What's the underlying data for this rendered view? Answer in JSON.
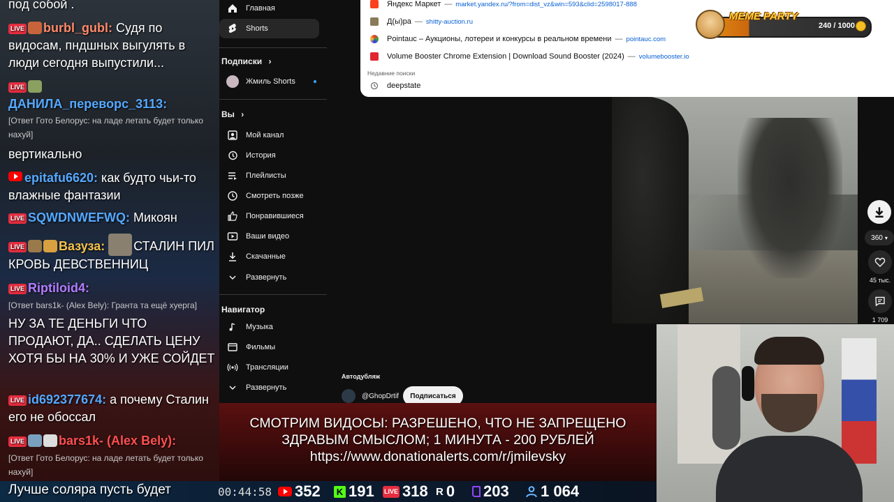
{
  "chat": {
    "line0": "под собой .",
    "m1_name": "burbl_gubl:",
    "m1_text": " Судя по видосам, пндшных выгулять в люди сегодня выпустили...",
    "m2_name": "ДАНИЛА_переворс_3113:",
    "m2_reply": "[Ответ Гото Белорус: на ладе летать будет только нахуй]",
    "m2_text": "вертикально",
    "m3_name": "epitafu6620:",
    "m3_text": " как будто чьи-то влажные фантазии",
    "m4_name": "SQWDNWEFWQ:",
    "m4_text": " Микоян",
    "m5_name": "Вазуза:",
    "m5_text": "СТАЛИН ПИЛ КРОВЬ ДЕВСТВЕННИЦ",
    "m6_name": "Riptiloid4:",
    "m6_reply": "[Ответ bars1k- (Alex Bely): Гранта та ещё хуерга]",
    "m6_text": "НУ ЗА ТЕ ДЕНЬГИ ЧТО ПРОДАЮТ, ДА.. СДЕЛАТЬ ЦЕНУ ХОТЯ БЫ НА 30% И УЖЕ СОЙДЕТ",
    "m7_name": "id692377674:",
    "m7_text": " а почему Сталин его не обоссал",
    "m8_name": "bars1k- (Alex Bely):",
    "m8_reply": "[Ответ Гото Белорус: на ладе летать будет только нахуй]",
    "last": "Лучше соляра пусть будет"
  },
  "sidebar": {
    "home": "Главная",
    "shorts": "Shorts",
    "subs_head": "Подписки",
    "sub1": "Жмиль Shorts",
    "you_head": "Вы",
    "channel": "Мой канал",
    "history": "История",
    "playlists": "Плейлисты",
    "watch_later": "Смотреть позже",
    "liked": "Понравившиеся",
    "your_videos": "Ваши видео",
    "downloads": "Скачанные",
    "expand1": "Развернуть",
    "nav_head": "Навигатор",
    "music": "Музыка",
    "movies": "Фильмы",
    "live": "Трансляции",
    "expand2": "Развернуть"
  },
  "dropdown": {
    "r1_title": "Яндекс Маркет",
    "r1_url": "market.yandex.ru/?from=dist_vz&win=593&clid=2598017-888",
    "r2_title": "Д(ы)ра",
    "r2_url": "shitty-auction.ru",
    "r3_title": "Pointauc – Аукционы, лотереи и конкурсы в реальном времени",
    "r3_url": "pointauc.com",
    "r4_title": "Volume Booster Chrome Extension | Download Sound Booster (2024)",
    "r4_url": "volumebooster.io",
    "recent_label": "Недавние поиски",
    "recent1": "deepstate",
    "sep": "—"
  },
  "meme": {
    "title": "MEME PARTY",
    "score": "240 / 1000",
    "progress": 0.24
  },
  "video": {
    "quality": "360",
    "likes": "45 тыс.",
    "comments": "1 709",
    "autodub": "Автодубляж",
    "channel": "@GhopDrtif",
    "subscribe": "Подписаться"
  },
  "banner": {
    "line1": "СМОТРИМ ВИДОСЫ: РАЗРЕШЕНО, ЧТО НЕ ЗАПРЕЩЕНО",
    "line2": "ЗДРАВЫМ СМЫСЛОМ; 1 МИНУТА - 200 РУБЛЕЙ",
    "line3": "https://www.donationalerts.com/r/jmilevsky"
  },
  "stats": {
    "timer": "00:44:58",
    "youtube": "352",
    "kick": "191",
    "live": "318",
    "rutube": "0",
    "twitch": "203",
    "viewers": "1 064"
  },
  "colors": {
    "youtube_red": "#ff0000",
    "live_badge": "#e52d3f",
    "kick_green": "#53fc18",
    "twitch_purple": "#9146ff",
    "link_blue": "#065fd4"
  }
}
